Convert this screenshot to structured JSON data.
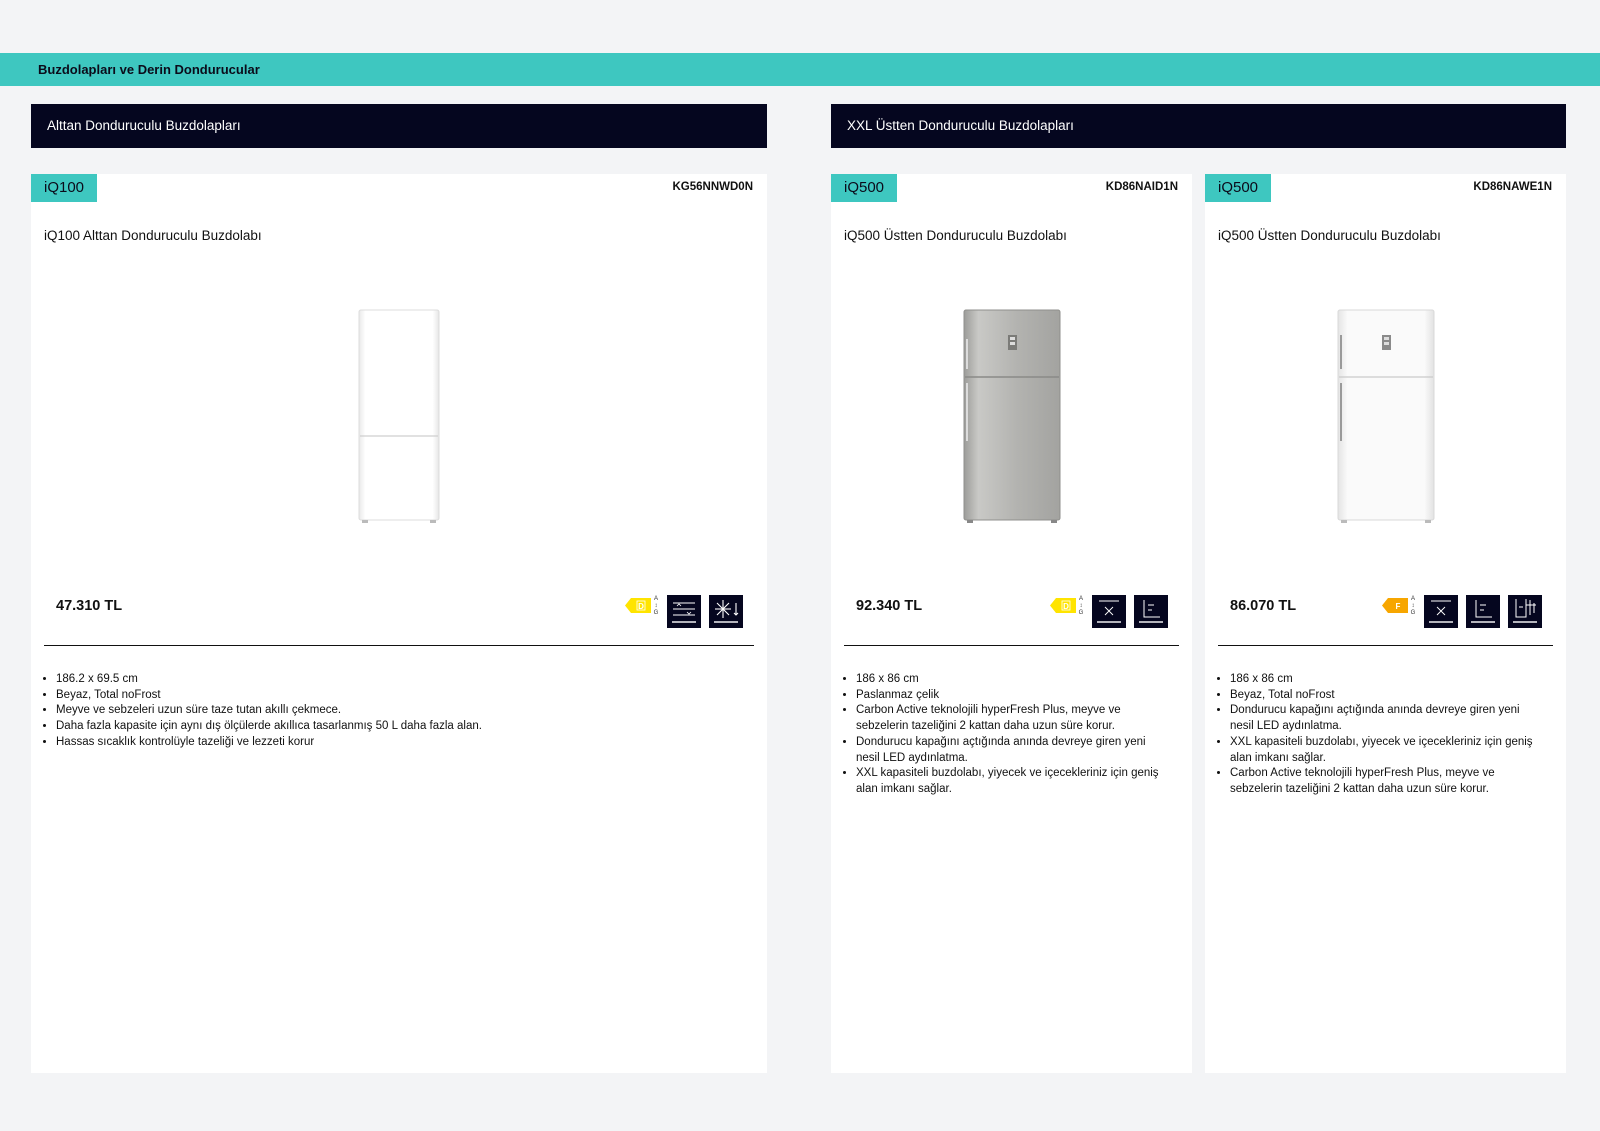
{
  "header": {
    "section_title": "Buzdolapları ve Derin Dondurucular"
  },
  "categories": [
    {
      "label": "Alttan Donduruculu Buzdolapları"
    },
    {
      "label": "XXL Üstten Donduruculu Buzdolapları"
    }
  ],
  "products": [
    {
      "series": "iQ100",
      "model": "KG56NNWD0N",
      "title": "iQ100 Alttan Donduruculu Buzdolabı",
      "price": "47.310 TL",
      "energy_class": "D",
      "energy_scale": [
        "A",
        "G"
      ],
      "finish_color": "#ffffff",
      "feature_icons": [
        "adjustable-shelf-icon",
        "nofrost-icon"
      ],
      "features": [
        "186.2 x 69.5 cm",
        "Beyaz, Total noFrost",
        "Meyve ve sebzeleri uzun süre taze tutan akıllı çekmece.",
        "Daha fazla kapasite için aynı dış ölçülerde akıllıca tasarlanmış 50 L daha fazla alan.",
        "Hassas sıcaklık kontrolüyle tazeliği ve lezzeti korur"
      ]
    },
    {
      "series": "iQ500",
      "model": "KD86NAID1N",
      "title": "iQ500 Üstten Donduruculu Buzdolabı",
      "price": "92.340 TL",
      "energy_class": "D",
      "energy_scale": [
        "A",
        "G"
      ],
      "finish_color": "#b8b8b5",
      "feature_icons": [
        "hyperfresh-icon",
        "xxl-capacity-icon"
      ],
      "features": [
        "186 x 86 cm",
        "Paslanmaz çelik",
        "Carbon Active teknolojili hyperFresh Plus, meyve ve sebzelerin tazeliğini 2 kattan daha uzun süre korur.",
        "Dondurucu kapağını açtığında anında devreye giren yeni nesil LED aydınlatma.",
        "XXL kapasiteli buzdolabı, yiyecek ve içecekleriniz için geniş alan imkanı sağlar."
      ]
    },
    {
      "series": "iQ500",
      "model": "KD86NAWE1N",
      "title": "iQ500 Üstten Donduruculu Buzdolabı",
      "price": "86.070 TL",
      "energy_class": "F",
      "energy_scale": [
        "A",
        "G"
      ],
      "finish_color": "#ffffff",
      "feature_icons": [
        "hyperfresh-icon",
        "xxl-capacity-icon",
        "led-light-icon"
      ],
      "features": [
        "186 x 86 cm",
        "Beyaz, Total noFrost",
        "Dondurucu kapağını açtığında anında devreye giren yeni nesil LED aydınlatma.",
        "XXL kapasiteli buzdolabı, yiyecek ve içecekleriniz için geniş alan imkanı sağlar.",
        "Carbon Active teknolojili hyperFresh Plus, meyve ve sebzelerin tazeliğini 2 kattan daha uzun süre korur."
      ]
    }
  ],
  "colors": {
    "teal": "#3ec7c0",
    "navy": "#05061f",
    "energy_yellow": "#ffe400",
    "energy_orange": "#f7a600"
  }
}
